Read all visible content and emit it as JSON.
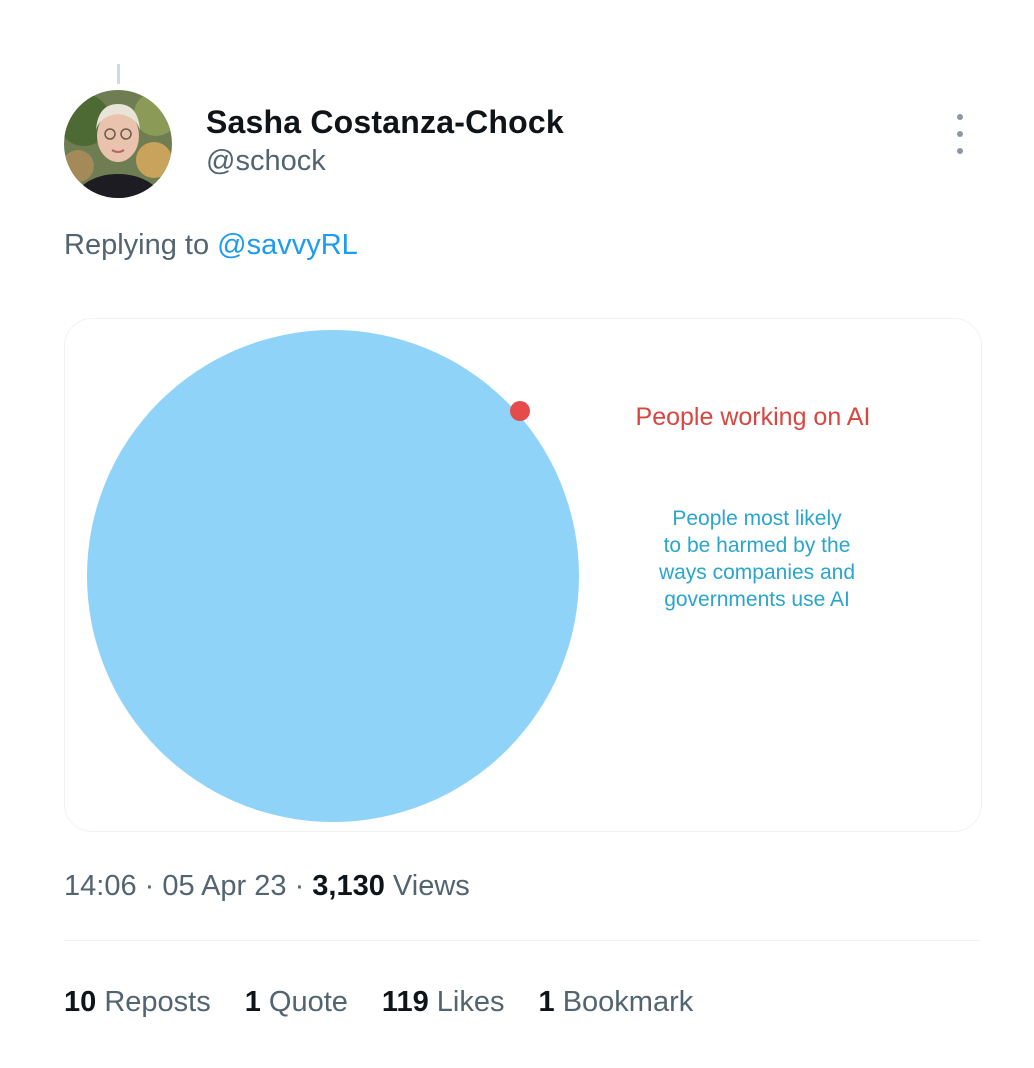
{
  "author": {
    "name": "Sasha Costanza-Chock",
    "handle": "@schock"
  },
  "reply": {
    "prefix": "Replying to",
    "mention": "@savvyRL"
  },
  "image": {
    "small_label": "People working on AI",
    "big_label_lines": [
      "People most likely",
      "to be harmed by the",
      "ways companies and",
      "governments use AI"
    ],
    "colors": {
      "big_circle": "#8fd3f8",
      "small_dot": "#e64b4b",
      "small_label": "#d9453f",
      "big_label": "#2aa5cc"
    }
  },
  "meta": {
    "time": "14:06",
    "separator": " · ",
    "date": "05 Apr 23",
    "views_count": "3,130",
    "views_label": " Views"
  },
  "stats": [
    {
      "count": "10",
      "label": "Reposts"
    },
    {
      "count": "1",
      "label": "Quote"
    },
    {
      "count": "119",
      "label": "Likes"
    },
    {
      "count": "1",
      "label": "Bookmark"
    }
  ],
  "colors": {
    "accent": "#1d9bf0",
    "secondary_text": "#536471"
  }
}
